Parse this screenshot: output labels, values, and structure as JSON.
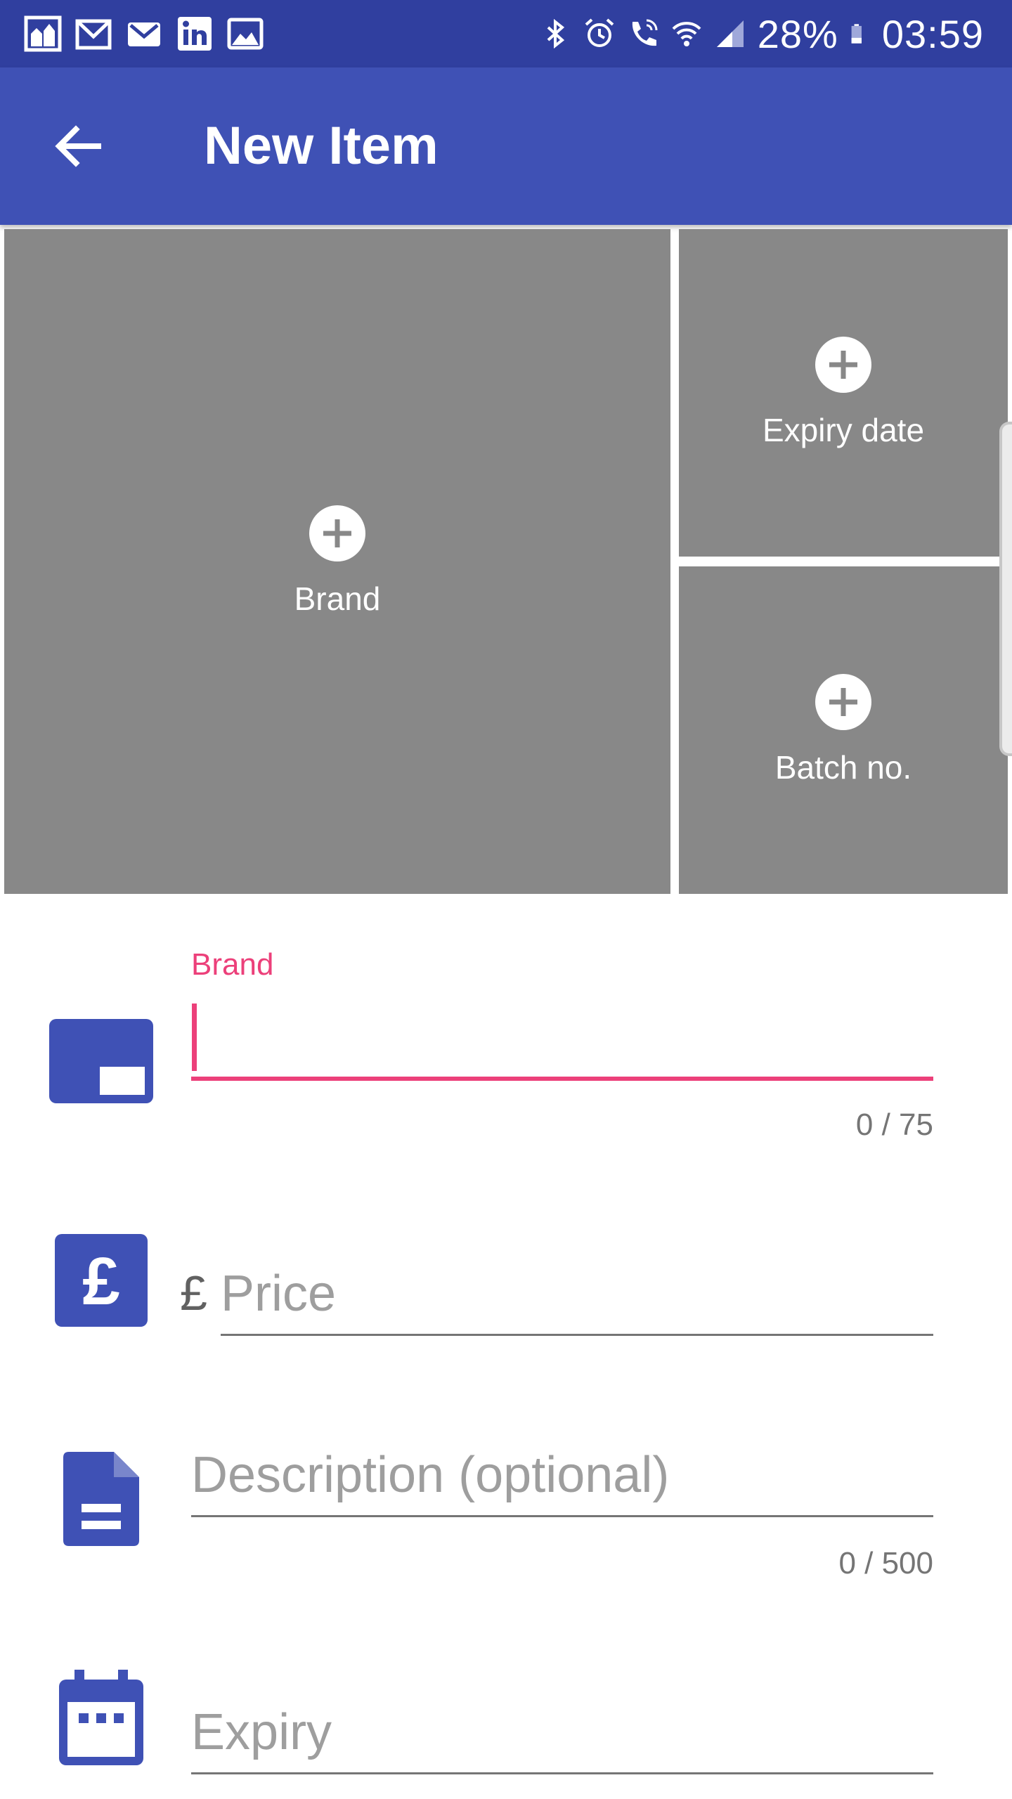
{
  "status_bar": {
    "left_icons": [
      "prayer-app-icon",
      "gmail-icon",
      "gmail-icon",
      "linkedin-icon",
      "gallery-icon"
    ],
    "right_icons": [
      "bluetooth-icon",
      "alarm-icon",
      "wifi-call-icon",
      "wifi-icon",
      "signal-icon",
      "battery-icon"
    ],
    "battery": "28%",
    "time": "03:59"
  },
  "app_bar": {
    "title": "New Item",
    "back_icon": "arrow-back-icon"
  },
  "photo_tiles": [
    {
      "label": "Brand"
    },
    {
      "label": "Expiry date"
    },
    {
      "label": "Batch no."
    }
  ],
  "form": {
    "brand": {
      "label": "Brand",
      "value": "",
      "counter": "0 / 75",
      "icon": "label-icon"
    },
    "price": {
      "currency": "£",
      "placeholder": "Price",
      "icon": "pound-icon"
    },
    "description": {
      "placeholder": "Description (optional)",
      "counter": "0 / 500",
      "icon": "document-icon"
    },
    "expiry": {
      "placeholder": "Expiry",
      "icon": "calendar-icon"
    }
  },
  "colors": {
    "status_bar": "#303f9f",
    "app_bar": "#3f51b5",
    "accent": "#ec407a",
    "tile": "#888888",
    "icon": "#3f51b5"
  }
}
